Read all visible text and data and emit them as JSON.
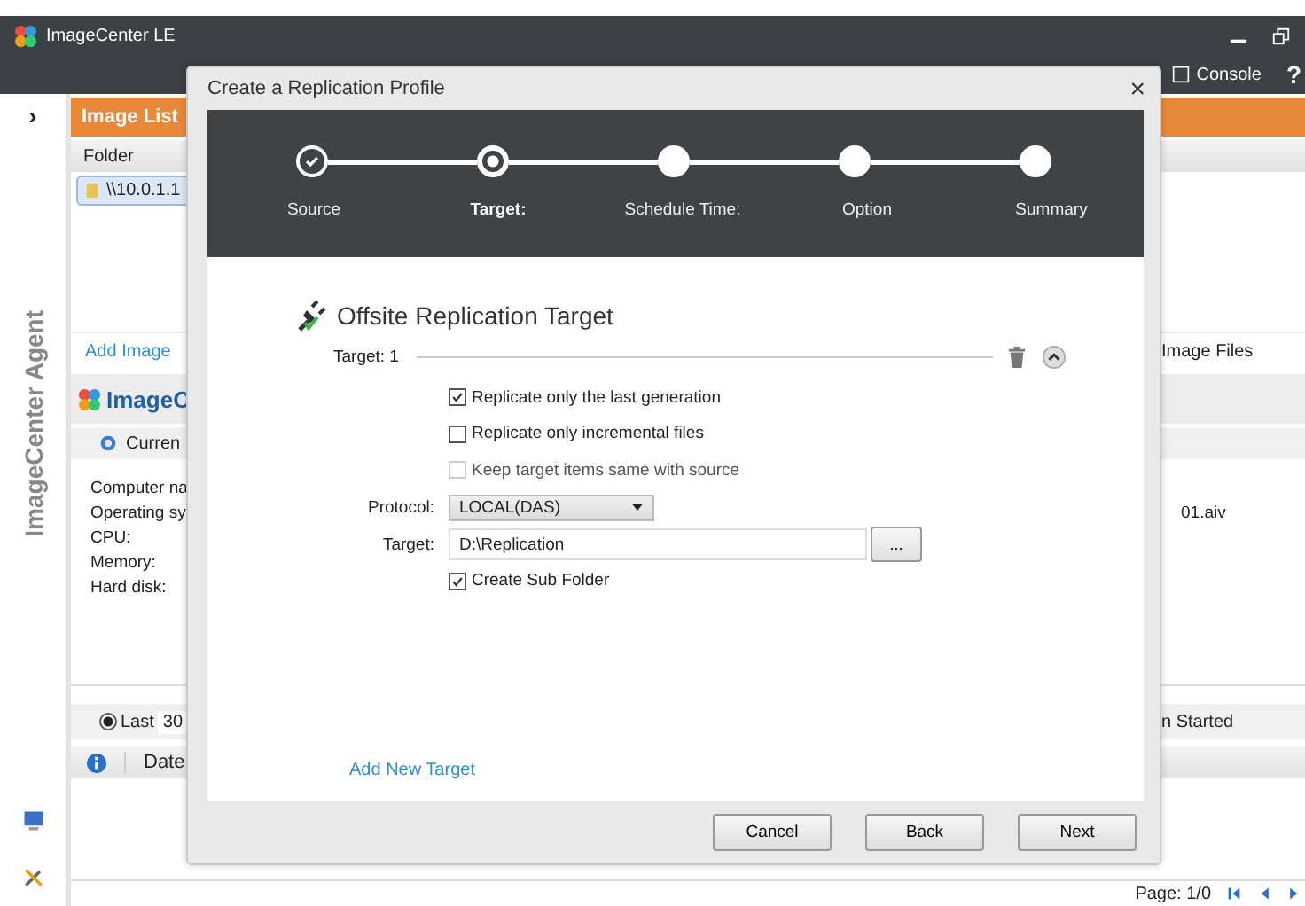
{
  "app": {
    "title": "ImageCenter LE",
    "console_label": "Console",
    "help_label": "?"
  },
  "rail": {
    "expand_glyph": "›",
    "agent_label": "ImageCenter Agent"
  },
  "image_list": {
    "title": "Image List",
    "folder_header": "Folder",
    "folders": [
      {
        "label": "\\\\10.0.1.1",
        "selected": true
      }
    ],
    "add_link": "Add Image",
    "column_right": "Image Files"
  },
  "agent_panel": {
    "logo_text": "ImageC",
    "tab": "Curren",
    "rows": [
      {
        "label": "Computer na",
        "value": ""
      },
      {
        "label": "Operating sy",
        "value": "01.aiv"
      },
      {
        "label": "CPU:",
        "value": ""
      },
      {
        "label": "Memory:",
        "value": ""
      },
      {
        "label": "Hard disk:",
        "value": ""
      }
    ]
  },
  "history": {
    "radio_label": "Last",
    "radio_selected": true,
    "count": "30",
    "right_header": "n Started",
    "date_header": "Date"
  },
  "status_bar": {
    "page": "Page: 1/0"
  },
  "dialog": {
    "title": "Create a Replication Profile",
    "close": "×",
    "steps": [
      {
        "label": "Source",
        "completed": true,
        "selected": false
      },
      {
        "label": "Target:",
        "completed": false,
        "selected": true
      },
      {
        "label": "Schedule Time:",
        "completed": false,
        "selected": false
      },
      {
        "label": "Option",
        "completed": false,
        "selected": false
      },
      {
        "label": "Summary",
        "completed": false,
        "selected": false
      }
    ],
    "section_title": "Offsite Replication Target",
    "target_heading": "Target: 1",
    "options": [
      {
        "label": "Replicate only the last generation",
        "checked": true,
        "disabled": false
      },
      {
        "label": "Replicate only incremental files",
        "checked": false,
        "disabled": false
      },
      {
        "label": "Keep target items same with source",
        "checked": false,
        "disabled": true
      }
    ],
    "protocol_label": "Protocol:",
    "protocol_value": "LOCAL(DAS)",
    "target_label": "Target:",
    "target_value": "D:\\Replication",
    "browse_label": "...",
    "sub_folder": {
      "label": "Create Sub Folder",
      "checked": true
    },
    "add_target_link": "Add New Target",
    "buttons": [
      "Cancel",
      "Back",
      "Next"
    ]
  }
}
